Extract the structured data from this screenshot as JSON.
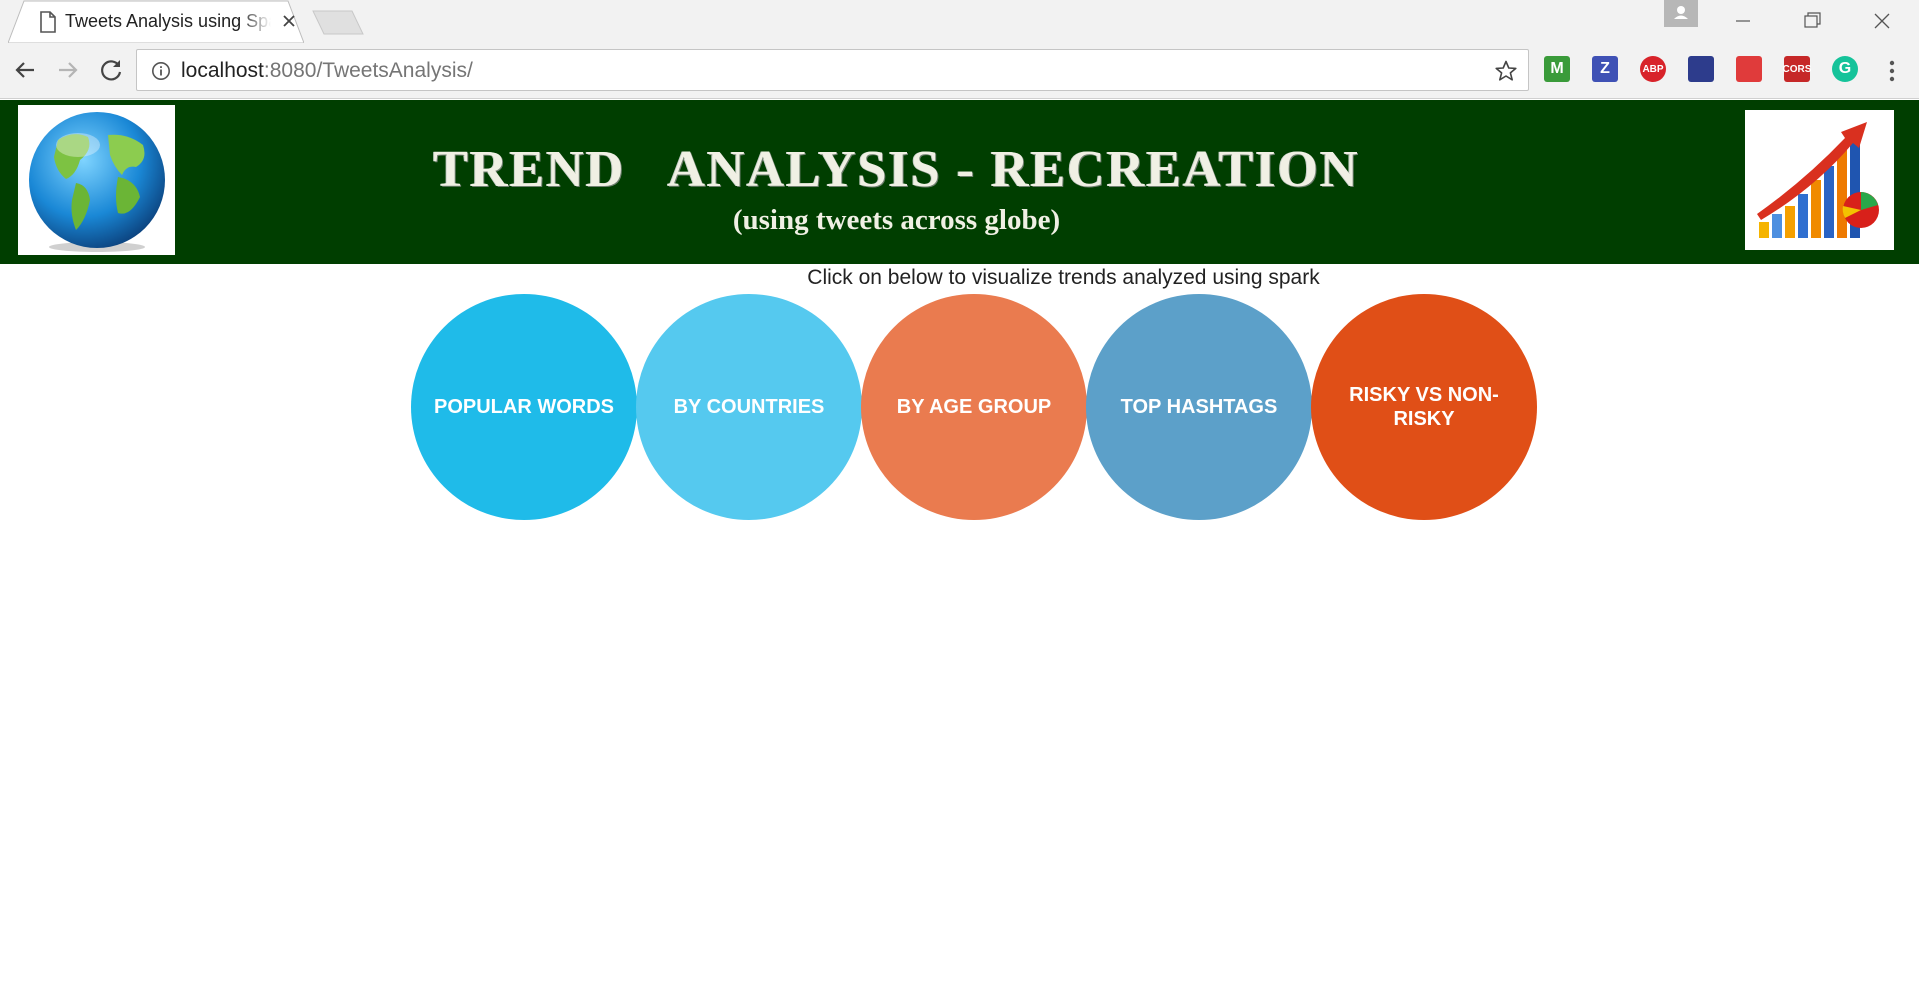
{
  "browser": {
    "tab": {
      "title": "Tweets Analysis using Spark"
    },
    "address": {
      "host": "localhost",
      "path": ":8080/TweetsAnalysis/"
    },
    "extensions": [
      {
        "name": "m-extension-icon",
        "label": "M",
        "color": "#3a9b3a"
      },
      {
        "name": "z-extension-icon",
        "label": "Z",
        "color": "#3f51b5"
      },
      {
        "name": "adblock-plus-icon",
        "label": "ABP",
        "color": "#d8232a"
      },
      {
        "name": "extension-icon-4",
        "label": "",
        "color": "#2d3c8c"
      },
      {
        "name": "extension-icon-5",
        "label": "",
        "color": "#e03b3b"
      },
      {
        "name": "cors-extension-icon",
        "label": "CORS",
        "color": "#c62828"
      },
      {
        "name": "grammarly-icon",
        "label": "G",
        "color": "#15c39a"
      }
    ]
  },
  "header": {
    "title": "TREND   ANALYSIS - RECREATION",
    "subtitle": "(using tweets across globe)",
    "left_logo": "globe-icon",
    "right_logo": "growth-chart-icon"
  },
  "main": {
    "instruction": "Click on below to visualize trends analyzed using spark",
    "buttons": [
      {
        "label": "POPULAR WORDS",
        "color": "#1fbbe9"
      },
      {
        "label": "BY COUNTRIES",
        "color": "#55c9ef"
      },
      {
        "label": "BY AGE GROUP",
        "color": "#ea7b4f"
      },
      {
        "label": "TOP HASHTAGS",
        "color": "#5ca0c9"
      },
      {
        "label": "RISKY VS NON-RISKY",
        "color": "#e04f17"
      }
    ]
  }
}
